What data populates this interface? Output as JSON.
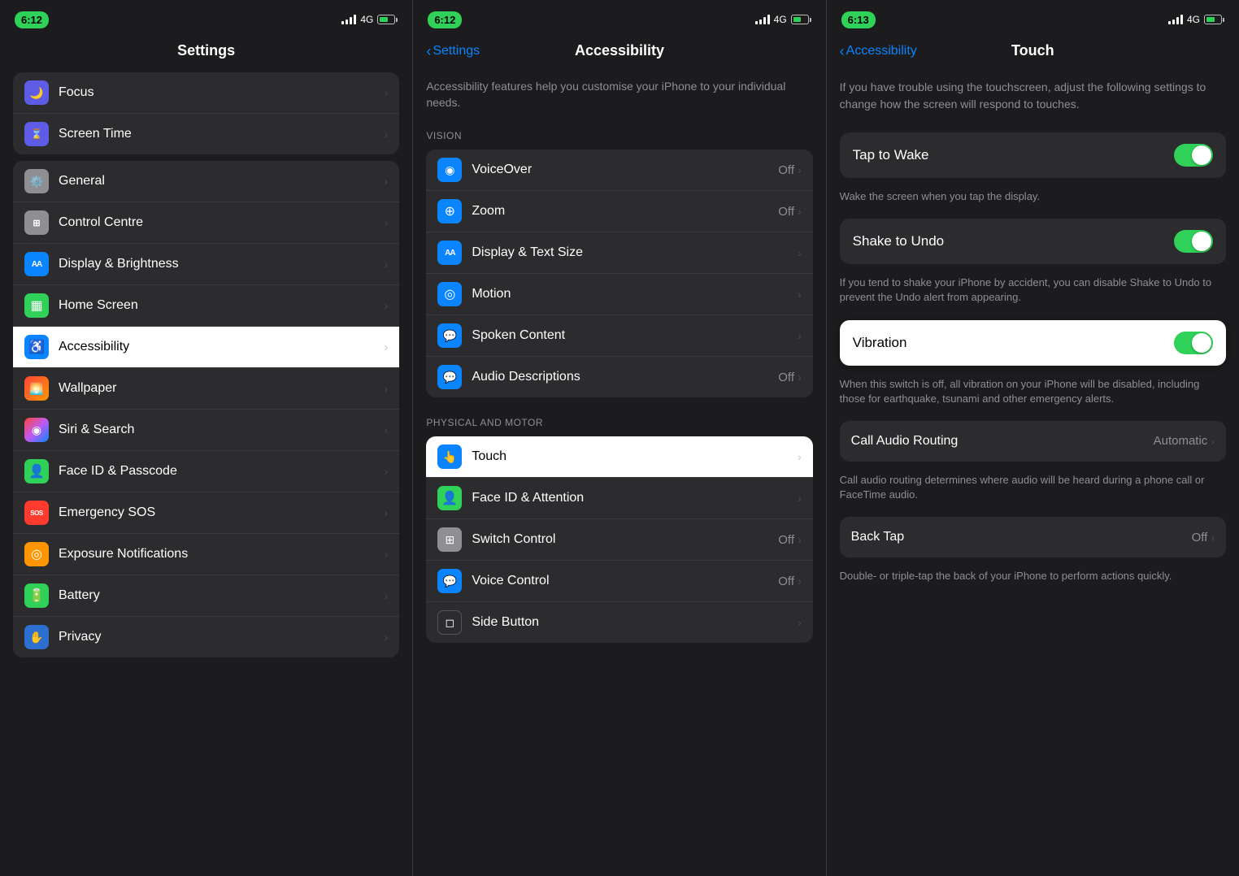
{
  "panels": {
    "panel1": {
      "status_time": "6:12",
      "signal_label": "4G",
      "nav_title": "Settings",
      "description": null,
      "items": [
        {
          "id": "focus",
          "label": "Focus",
          "icon_bg": "#5e5ce6",
          "icon": "🌙",
          "value": "",
          "has_chevron": true
        },
        {
          "id": "screen-time",
          "label": "Screen Time",
          "icon_bg": "#5e5ce6",
          "icon": "⌛",
          "value": "",
          "has_chevron": true
        },
        {
          "id": "general",
          "label": "General",
          "icon_bg": "#8e8e93",
          "icon": "⚙️",
          "value": "",
          "has_chevron": true
        },
        {
          "id": "control-centre",
          "label": "Control Centre",
          "icon_bg": "#8e8e93",
          "icon": "⊞",
          "value": "",
          "has_chevron": true
        },
        {
          "id": "display-brightness",
          "label": "Display & Brightness",
          "icon_bg": "#0a84ff",
          "icon": "AA",
          "value": "",
          "has_chevron": true
        },
        {
          "id": "home-screen",
          "label": "Home Screen",
          "icon_bg": "#30d158",
          "icon": "▦",
          "value": "",
          "has_chevron": true
        },
        {
          "id": "accessibility",
          "label": "Accessibility",
          "icon_bg": "#0a84ff",
          "icon": "♿",
          "value": "",
          "has_chevron": true,
          "selected": true
        },
        {
          "id": "wallpaper",
          "label": "Wallpaper",
          "icon_bg": "#ff453a",
          "icon": "🌅",
          "value": "",
          "has_chevron": true
        },
        {
          "id": "siri-search",
          "label": "Siri & Search",
          "icon_bg": "#2c2c2e",
          "icon": "◉",
          "value": "",
          "has_chevron": true
        },
        {
          "id": "face-id-passcode",
          "label": "Face ID & Passcode",
          "icon_bg": "#30d158",
          "icon": "👤",
          "value": "",
          "has_chevron": true
        },
        {
          "id": "emergency-sos",
          "label": "Emergency SOS",
          "icon_bg": "#ff3b30",
          "icon": "SOS",
          "value": "",
          "has_chevron": true
        },
        {
          "id": "exposure",
          "label": "Exposure Notifications",
          "icon_bg": "#ff9500",
          "icon": "◎",
          "value": "",
          "has_chevron": true
        },
        {
          "id": "battery",
          "label": "Battery",
          "icon_bg": "#30d158",
          "icon": "🔋",
          "value": "",
          "has_chevron": true
        },
        {
          "id": "privacy",
          "label": "Privacy",
          "icon_bg": "#2c6fce",
          "icon": "✋",
          "value": "",
          "has_chevron": true
        }
      ]
    },
    "panel2": {
      "status_time": "6:12",
      "signal_label": "4G",
      "nav_back_label": "Settings",
      "nav_title": "Accessibility",
      "description": "Accessibility features help you customise your iPhone to your individual needs.",
      "section_vision": "VISION",
      "section_physical": "PHYSICAL AND MOTOR",
      "vision_items": [
        {
          "id": "voiceover",
          "label": "VoiceOver",
          "icon_bg": "#0a84ff",
          "icon": "◉",
          "value": "Off",
          "has_chevron": true
        },
        {
          "id": "zoom",
          "label": "Zoom",
          "icon_bg": "#0a84ff",
          "icon": "⊕",
          "value": "Off",
          "has_chevron": true
        },
        {
          "id": "display-text-size",
          "label": "Display & Text Size",
          "icon_bg": "#0a84ff",
          "icon": "AA",
          "value": "",
          "has_chevron": true
        },
        {
          "id": "motion",
          "label": "Motion",
          "icon_bg": "#0a84ff",
          "icon": "◎",
          "value": "",
          "has_chevron": true
        },
        {
          "id": "spoken-content",
          "label": "Spoken Content",
          "icon_bg": "#0a84ff",
          "icon": "💬",
          "value": "",
          "has_chevron": true
        },
        {
          "id": "audio-descriptions",
          "label": "Audio Descriptions",
          "icon_bg": "#0a84ff",
          "icon": "💬",
          "value": "Off",
          "has_chevron": true
        }
      ],
      "physical_items": [
        {
          "id": "touch",
          "label": "Touch",
          "icon_bg": "#0a84ff",
          "icon": "👆",
          "value": "",
          "has_chevron": true,
          "highlighted": true
        },
        {
          "id": "face-id-attention",
          "label": "Face ID & Attention",
          "icon_bg": "#30d158",
          "icon": "👤",
          "value": "",
          "has_chevron": true
        },
        {
          "id": "switch-control",
          "label": "Switch Control",
          "icon_bg": "#8e8e93",
          "icon": "⊞",
          "value": "Off",
          "has_chevron": true
        },
        {
          "id": "voice-control",
          "label": "Voice Control",
          "icon_bg": "#0a84ff",
          "icon": "💬",
          "value": "Off",
          "has_chevron": true
        },
        {
          "id": "side-button",
          "label": "Side Button",
          "icon_bg": "#2c2c2e",
          "icon": "◻",
          "value": "",
          "has_chevron": true
        }
      ]
    },
    "panel3": {
      "status_time": "6:13",
      "signal_label": "4G",
      "nav_back_label": "Accessibility",
      "nav_title": "Touch",
      "intro": "If you have trouble using the touchscreen, adjust the following settings to change how the screen will respond to touches.",
      "tap_to_wake_label": "Tap to Wake",
      "tap_to_wake_on": true,
      "tap_to_wake_desc": "Wake the screen when you tap the display.",
      "shake_to_undo_label": "Shake to Undo",
      "shake_to_undo_on": true,
      "shake_to_undo_desc": "If you tend to shake your iPhone by accident, you can disable Shake to Undo to prevent the Undo alert from appearing.",
      "vibration_label": "Vibration",
      "vibration_on": true,
      "vibration_desc": "When this switch is off, all vibration on your iPhone will be disabled, including those for earthquake, tsunami and other emergency alerts.",
      "call_audio_label": "Call Audio Routing",
      "call_audio_value": "Automatic",
      "call_audio_desc": "Call audio routing determines where audio will be heard during a phone call or FaceTime audio.",
      "back_tap_label": "Back Tap",
      "back_tap_value": "Off",
      "back_tap_desc": "Double- or triple-tap the back of your iPhone to perform actions quickly."
    }
  }
}
